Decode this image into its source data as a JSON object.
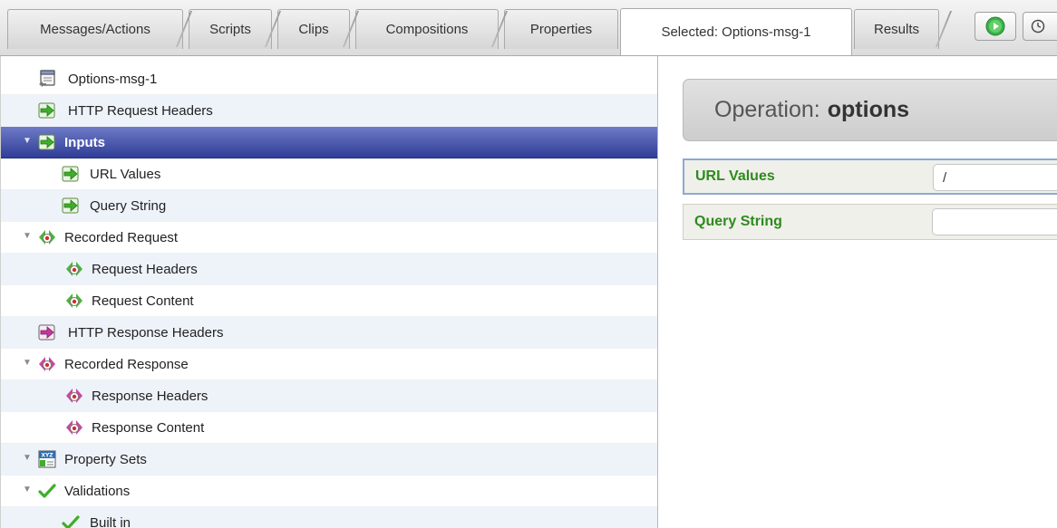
{
  "tabs": [
    {
      "label": "Messages/Actions"
    },
    {
      "label": "Scripts"
    },
    {
      "label": "Clips"
    },
    {
      "label": "Compositions"
    },
    {
      "label": "Properties"
    },
    {
      "label": "Selected: Options-msg-1"
    },
    {
      "label": "Results"
    }
  ],
  "active_tab": "Selected: Options-msg-1",
  "tree": {
    "items": [
      {
        "label": "Options-msg-1",
        "icon": "message-icon"
      },
      {
        "label": "HTTP Request Headers",
        "icon": "green-arrow-icon"
      },
      {
        "label": "Inputs",
        "icon": "green-arrow-icon",
        "expanded": true,
        "selected": true
      },
      {
        "label": "URL Values",
        "icon": "green-arrow-icon"
      },
      {
        "label": "Query String",
        "icon": "green-arrow-icon"
      },
      {
        "label": "Recorded Request",
        "icon": "recorded-request-icon",
        "expanded": true
      },
      {
        "label": "Request Headers",
        "icon": "recorded-request-icon"
      },
      {
        "label": "Request Content",
        "icon": "recorded-request-icon"
      },
      {
        "label": "HTTP Response Headers",
        "icon": "pink-arrow-icon"
      },
      {
        "label": "Recorded Response",
        "icon": "recorded-response-icon",
        "expanded": true
      },
      {
        "label": "Response Headers",
        "icon": "recorded-response-icon"
      },
      {
        "label": "Response Content",
        "icon": "recorded-response-icon"
      },
      {
        "label": "Property Sets",
        "icon": "property-sets-icon",
        "expanded": true
      },
      {
        "label": "Validations",
        "icon": "checkmark-icon",
        "expanded": true
      },
      {
        "label": "Built in",
        "icon": "checkmark-icon"
      }
    ]
  },
  "operation": {
    "prefix": "Operation:",
    "name": "options"
  },
  "fields": [
    {
      "label": "URL Values",
      "value": "/"
    },
    {
      "label": "Query String",
      "value": ""
    }
  ],
  "colors": {
    "selection": "#2f3d97",
    "field_label": "#2e8a1f",
    "green_arrow": "#3fae2a",
    "pink_arrow": "#c0399c"
  }
}
